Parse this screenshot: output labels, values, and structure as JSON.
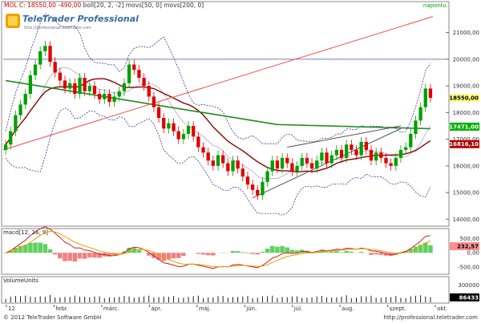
{
  "header": {
    "instrument": "MOL C: 18550,00",
    "change": "-490,00",
    "indicators": "boll[20, 2, -2]  movs[50, 0]  movs[200, 0]",
    "period": "napontu"
  },
  "branding": {
    "logo_text": "TeleTrader Professional",
    "logo_url": "http://professional.teletrader.com"
  },
  "footer": {
    "copyright": "© 2012 TeleTrader Software GmbH",
    "url": "http://professional.teletrader.com"
  },
  "colors": {
    "price_up": "#00a000",
    "price_down": "#e00000",
    "ma50": "#8b0000",
    "ma200": "#228b22",
    "bollinger": "#1a1a80",
    "trendline": "#e85050",
    "support": "#404040",
    "macd_line": "#cc2222",
    "signal_line": "#e8a000",
    "volume": "#202020",
    "price_label_bg": "#ffff80",
    "ma200_label_bg": "#00b000",
    "ma50_label_bg": "#b00000",
    "macd_label_bg": "#ff9090"
  },
  "chart_data": [
    {
      "type": "candlestick",
      "title": "MOL C: 18550,00",
      "indicators": [
        "boll[20, 2, -2]",
        "movs[50, 0]",
        "movs[200, 0]"
      ],
      "ylim": [
        13800,
        21800
      ],
      "yticks": [
        "14000,00",
        "15000,00",
        "16000,00",
        "17000,00",
        "18000,00",
        "19000,00",
        "20000,00",
        "21000,00"
      ],
      "x_months": [
        "12",
        "febr.",
        "márc.",
        "ápr.",
        "máj.",
        "jún.",
        "júl.",
        "aug.",
        "szept.",
        "okt."
      ],
      "last_price": "18550,00",
      "ma200_label": "17471,00",
      "ma50_label": "16816,10",
      "horizontal_level": 20000,
      "series_close": [
        16800,
        17300,
        17900,
        18300,
        18700,
        19400,
        19800,
        20300,
        20500,
        19900,
        19500,
        19200,
        18900,
        19100,
        18700,
        19300,
        18800,
        19000,
        18700,
        18500,
        18700,
        18400,
        18600,
        18800,
        19100,
        19800,
        19600,
        19300,
        19000,
        18600,
        18200,
        17800,
        17400,
        17600,
        17300,
        17000,
        17200,
        17500,
        17100,
        16700,
        16500,
        16200,
        16000,
        16400,
        16100,
        15800,
        16200,
        15900,
        15600,
        15300,
        15100,
        14900,
        15400,
        15800,
        16200,
        15900,
        16300,
        16100,
        15800,
        16000,
        16300,
        16100,
        15900,
        16200,
        16500,
        16100,
        16400,
        16600,
        16300,
        16800,
        16600,
        16400,
        16900,
        16600,
        16200,
        16500,
        16300,
        16100,
        16000,
        16300,
        16600,
        16700,
        17200,
        17700,
        18200,
        18900,
        18550
      ]
    },
    {
      "type": "line",
      "title": "macd[12, 26, 9]",
      "last_value": "232,57",
      "yticks": [
        "500,00",
        "0,00",
        "-500,00"
      ],
      "ylim": [
        -700,
        600
      ]
    },
    {
      "type": "bar",
      "title": "VolumeUnits",
      "last_value": "86433",
      "yticks": [
        "300000",
        "100000"
      ],
      "ylim": [
        0,
        320000
      ]
    }
  ]
}
